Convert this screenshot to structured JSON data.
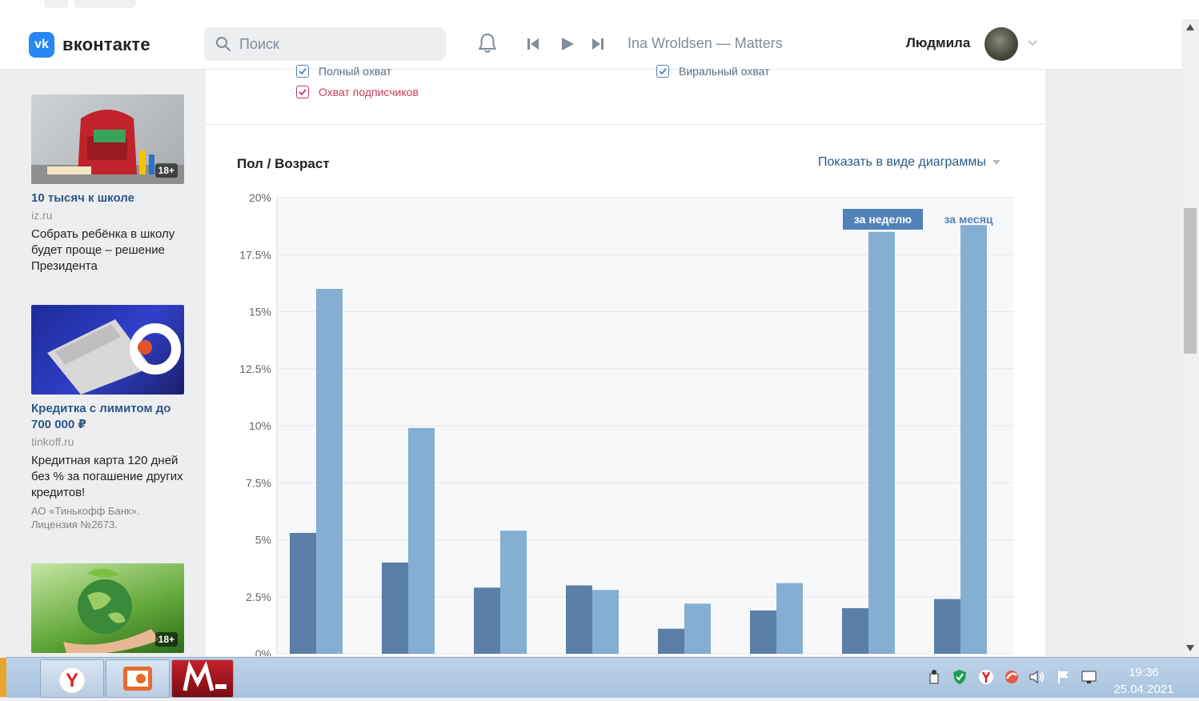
{
  "header": {
    "brand": "вконтакте",
    "logo_letters": "vk",
    "search_placeholder": "Поиск",
    "now_playing": "Ina Wroldsen — Matters",
    "user_name": "Людмила"
  },
  "ads": [
    {
      "title": "10 тысяч к школе",
      "domain": "iz.ru",
      "text": "Собрать ребёнка в школу будет проще – решение Президента",
      "age": "18+"
    },
    {
      "title": "Кредитка с лимитом до 700 000 ₽",
      "domain": "tinkoff.ru",
      "text": "Кредитная карта 120 дней без % за погашение других кредитов!",
      "note": "АО «Тинькофф Банк». Лицензия №2673."
    },
    {
      "age": "18+"
    }
  ],
  "stats": {
    "checkbox_top_left": "Полный охват",
    "checkbox_top_right": "Виральный охват",
    "checkbox_subscribers": "Охват подписчиков",
    "section_title": "Пол / Возраст",
    "show_as": "Показать в виде диаграммы"
  },
  "chart_data": {
    "type": "bar",
    "y_ticks": [
      "20%",
      "17.5%",
      "15%",
      "12.5%",
      "10%",
      "7.5%",
      "5%",
      "2.5%",
      "0%"
    ],
    "ylim": [
      0,
      20
    ],
    "categories": [
      "",
      "",
      "",
      "",
      "",
      "",
      "",
      ""
    ],
    "series": [
      {
        "name": "за неделю",
        "color": "#5b7fa6",
        "values": [
          5.3,
          4.0,
          2.9,
          3.0,
          1.1,
          1.9,
          2.0,
          2.4
        ]
      },
      {
        "name": "за месяц",
        "color": "#85aed3",
        "values": [
          16.0,
          9.9,
          5.4,
          2.8,
          2.2,
          3.1,
          18.5,
          18.8
        ]
      }
    ],
    "legend_active": "за неделю",
    "legend_inactive": "за месяц",
    "grid": true,
    "legend_position": "top-right"
  },
  "taskbar": {
    "clock_time": "19:36",
    "clock_date": "25.04.2021",
    "yandex_letter": "Y"
  }
}
